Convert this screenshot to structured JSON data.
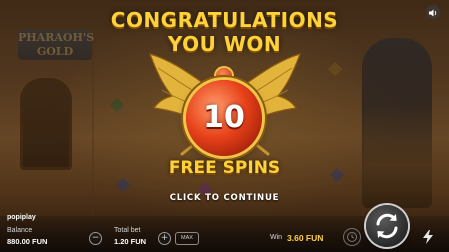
{
  "game": {
    "logo_text": "PHARAOH'S GOLD"
  },
  "popup": {
    "headline_line1": "CONGRATULATIONS",
    "headline_line2": "YOU WON",
    "spins_count": "10",
    "award_label": "FREE SPINS",
    "continue_prompt": "CLICK TO CONTINUE"
  },
  "bottom_bar": {
    "brand": "popiplay",
    "balance_label": "Balance",
    "balance_value": "880.00 FUN",
    "total_bet_label": "Total bet",
    "total_bet_value": "1.20 FUN",
    "minus_symbol": "−",
    "plus_symbol": "+",
    "max_label": "MAX",
    "win_label": "Win",
    "win_value": "3.60 FUN"
  },
  "icons": {
    "sound": "speaker-icon",
    "spin": "refresh-icon",
    "turbo": "lightning-icon",
    "autoplay": "autoplay-icon"
  },
  "colors": {
    "headline": "#ffd23a",
    "orb": "#e8421a",
    "wing_gold": "#e3b43c"
  }
}
